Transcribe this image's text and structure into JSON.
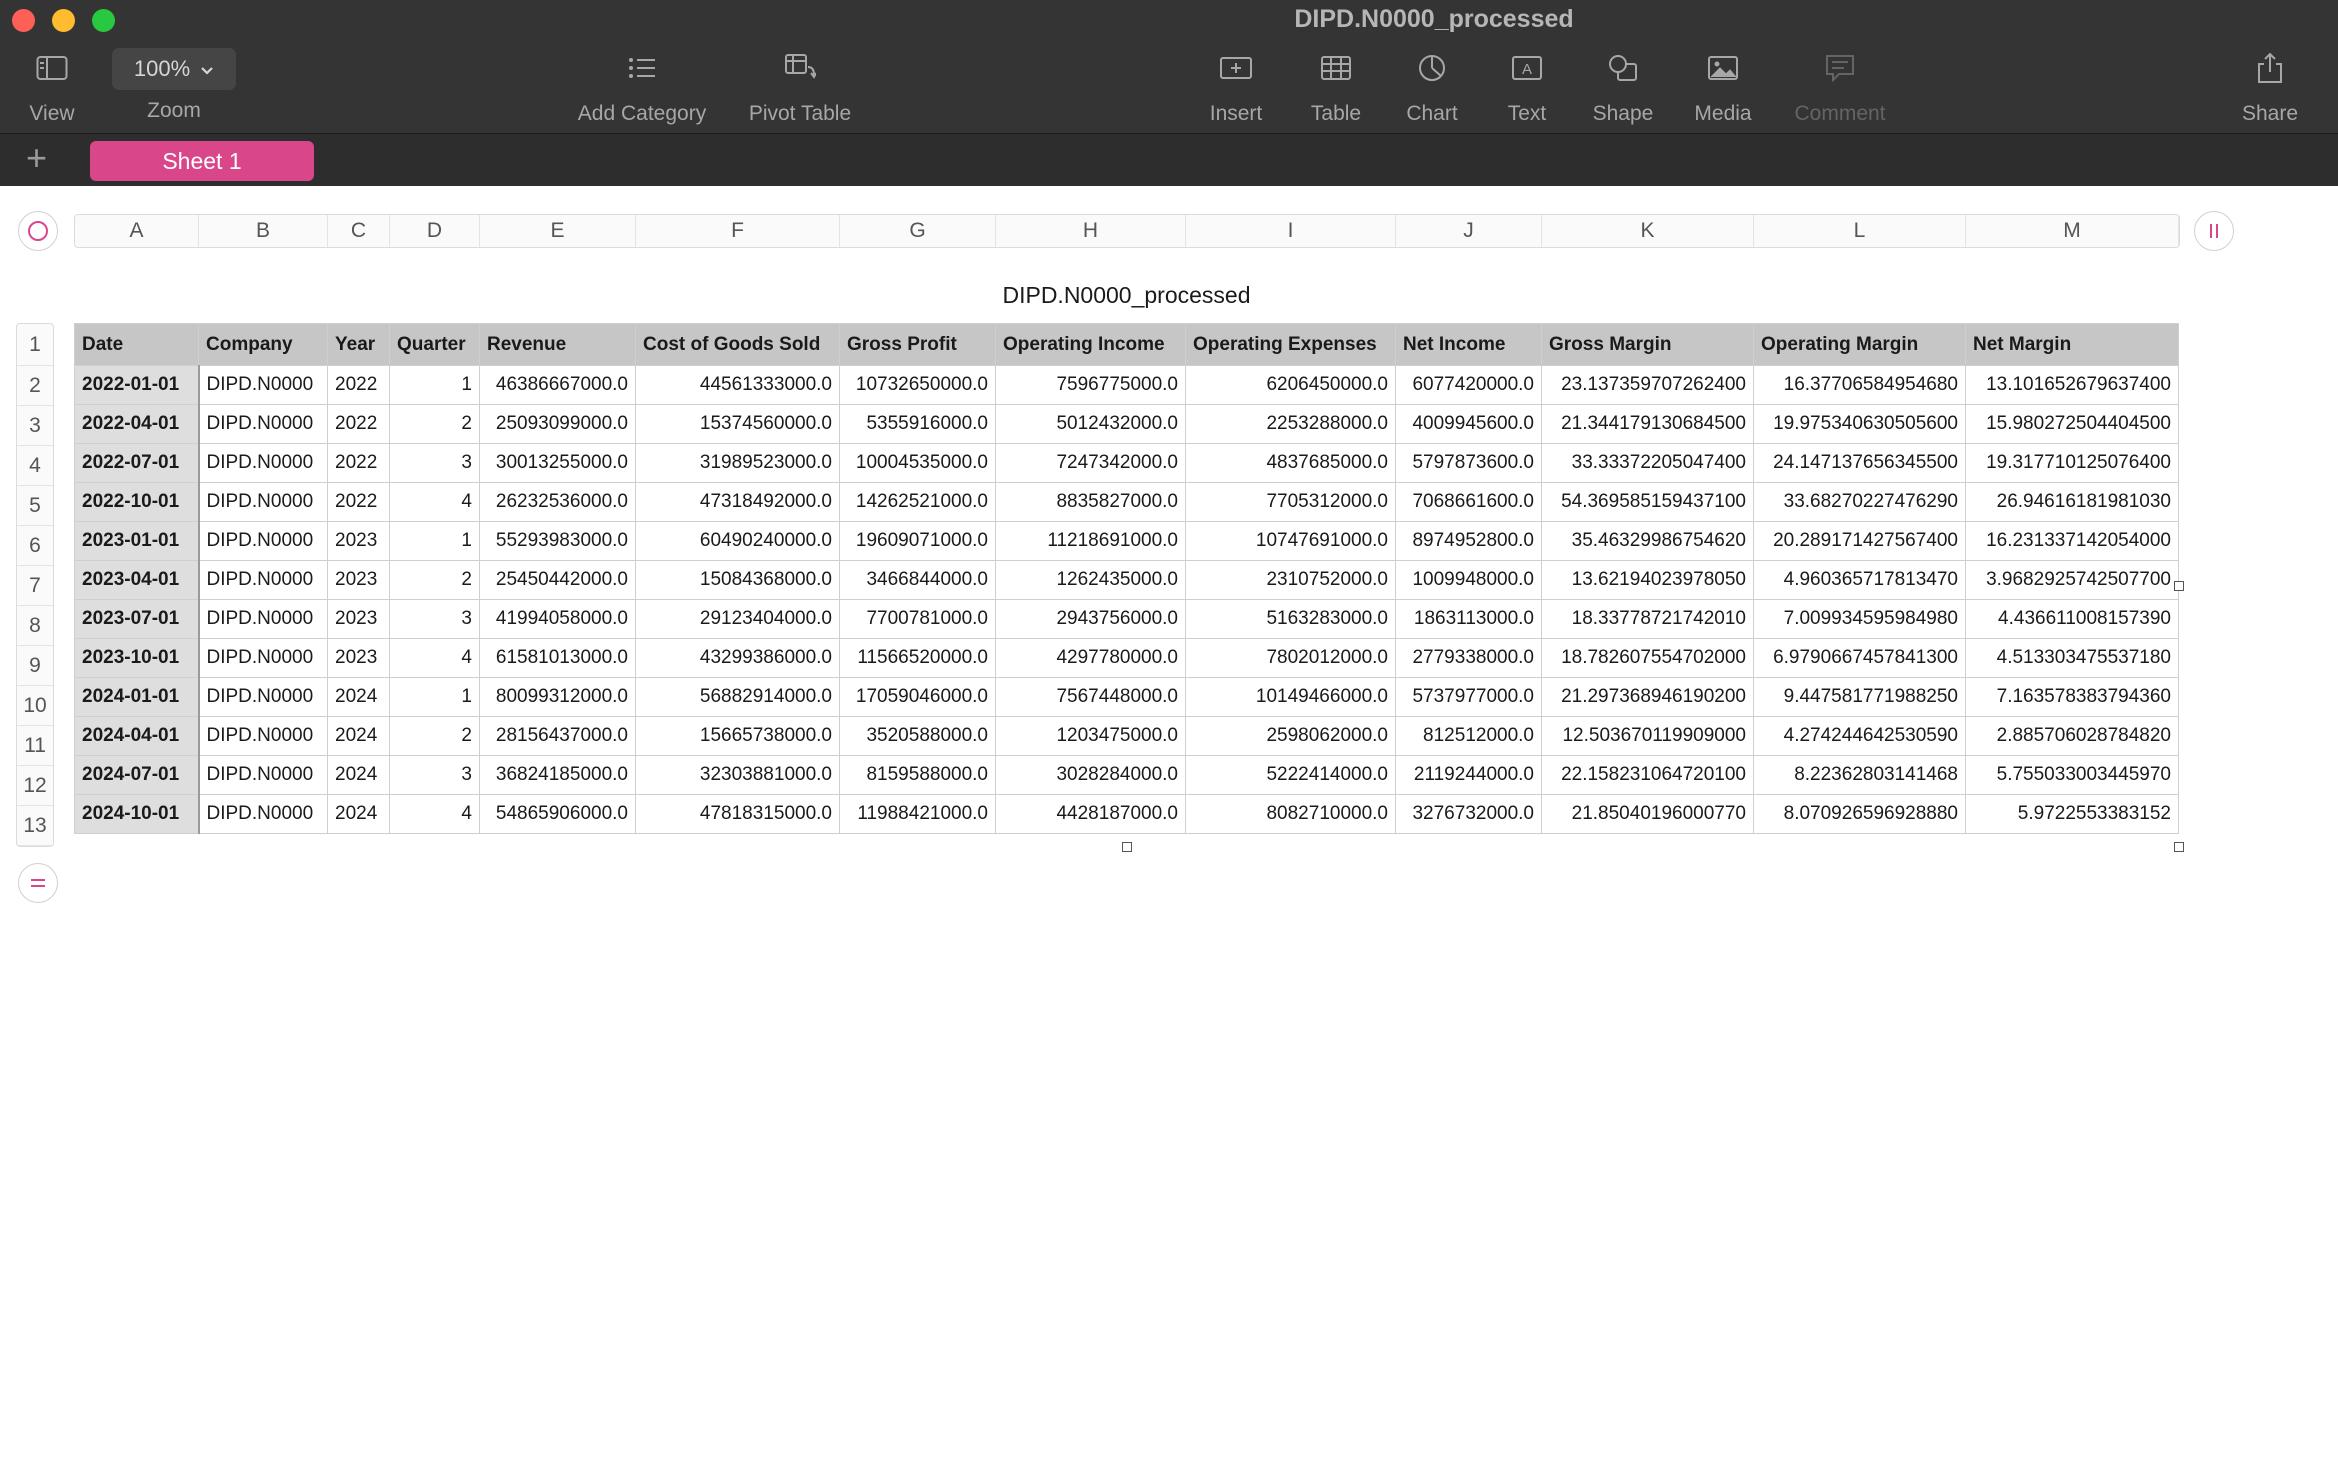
{
  "window": {
    "title": "DIPD.N0000_processed"
  },
  "toolbar": {
    "view": "View",
    "zoom_value": "100%",
    "zoom": "Zoom",
    "add_category": "Add Category",
    "pivot_table": "Pivot Table",
    "insert": "Insert",
    "table": "Table",
    "chart": "Chart",
    "text": "Text",
    "shape": "Shape",
    "media": "Media",
    "comment": "Comment",
    "share": "Share"
  },
  "sheets": {
    "add": "+",
    "active": "Sheet 1"
  },
  "columns": [
    "A",
    "B",
    "C",
    "D",
    "E",
    "F",
    "G",
    "H",
    "I",
    "J",
    "K",
    "L",
    "M"
  ],
  "rows": [
    "1",
    "2",
    "3",
    "4",
    "5",
    "6",
    "7",
    "8",
    "9",
    "10",
    "11",
    "12",
    "13"
  ],
  "table": {
    "title": "DIPD.N0000_processed",
    "headers": [
      "Date",
      "Company",
      "Year",
      "Quarter",
      "Revenue",
      "Cost of Goods Sold",
      "Gross Profit",
      "Operating Income",
      "Operating Expenses",
      "Net Income",
      "Gross Margin",
      "Operating Margin",
      "Net Margin"
    ],
    "data": [
      [
        "2022-01-01",
        "DIPD.N0000",
        "2022",
        "1",
        "46386667000.0",
        "44561333000.0",
        "10732650000.0",
        "7596775000.0",
        "6206450000.0",
        "6077420000.0",
        "23.137359707262400",
        "16.37706584954680",
        "13.101652679637400"
      ],
      [
        "2022-04-01",
        "DIPD.N0000",
        "2022",
        "2",
        "25093099000.0",
        "15374560000.0",
        "5355916000.0",
        "5012432000.0",
        "2253288000.0",
        "4009945600.0",
        "21.344179130684500",
        "19.975340630505600",
        "15.980272504404500"
      ],
      [
        "2022-07-01",
        "DIPD.N0000",
        "2022",
        "3",
        "30013255000.0",
        "31989523000.0",
        "10004535000.0",
        "7247342000.0",
        "4837685000.0",
        "5797873600.0",
        "33.33372205047400",
        "24.147137656345500",
        "19.317710125076400"
      ],
      [
        "2022-10-01",
        "DIPD.N0000",
        "2022",
        "4",
        "26232536000.0",
        "47318492000.0",
        "14262521000.0",
        "8835827000.0",
        "7705312000.0",
        "7068661600.0",
        "54.369585159437100",
        "33.68270227476290",
        "26.94616181981030"
      ],
      [
        "2023-01-01",
        "DIPD.N0000",
        "2023",
        "1",
        "55293983000.0",
        "60490240000.0",
        "19609071000.0",
        "11218691000.0",
        "10747691000.0",
        "8974952800.0",
        "35.46329986754620",
        "20.289171427567400",
        "16.231337142054000"
      ],
      [
        "2023-04-01",
        "DIPD.N0000",
        "2023",
        "2",
        "25450442000.0",
        "15084368000.0",
        "3466844000.0",
        "1262435000.0",
        "2310752000.0",
        "1009948000.0",
        "13.62194023978050",
        "4.960365717813470",
        "3.9682925742507700"
      ],
      [
        "2023-07-01",
        "DIPD.N0000",
        "2023",
        "3",
        "41994058000.0",
        "29123404000.0",
        "7700781000.0",
        "2943756000.0",
        "5163283000.0",
        "1863113000.0",
        "18.33778721742010",
        "7.009934595984980",
        "4.436611008157390"
      ],
      [
        "2023-10-01",
        "DIPD.N0000",
        "2023",
        "4",
        "61581013000.0",
        "43299386000.0",
        "11566520000.0",
        "4297780000.0",
        "7802012000.0",
        "2779338000.0",
        "18.782607554702000",
        "6.9790667457841300",
        "4.513303475537180"
      ],
      [
        "2024-01-01",
        "DIPD.N0000",
        "2024",
        "1",
        "80099312000.0",
        "56882914000.0",
        "17059046000.0",
        "7567448000.0",
        "10149466000.0",
        "5737977000.0",
        "21.297368946190200",
        "9.447581771988250",
        "7.163578383794360"
      ],
      [
        "2024-04-01",
        "DIPD.N0000",
        "2024",
        "2",
        "28156437000.0",
        "15665738000.0",
        "3520588000.0",
        "1203475000.0",
        "2598062000.0",
        "812512000.0",
        "12.503670119909000",
        "4.274244642530590",
        "2.885706028784820"
      ],
      [
        "2024-07-01",
        "DIPD.N0000",
        "2024",
        "3",
        "36824185000.0",
        "32303881000.0",
        "8159588000.0",
        "3028284000.0",
        "5222414000.0",
        "2119244000.0",
        "22.158231064720100",
        "8.22362803141468",
        "5.755033003445970"
      ],
      [
        "2024-10-01",
        "DIPD.N0000",
        "2024",
        "4",
        "54865906000.0",
        "47818315000.0",
        "11988421000.0",
        "4428187000.0",
        "8082710000.0",
        "3276732000.0",
        "21.85040196000770",
        "8.070926596928880",
        "5.9722553383152"
      ]
    ]
  }
}
